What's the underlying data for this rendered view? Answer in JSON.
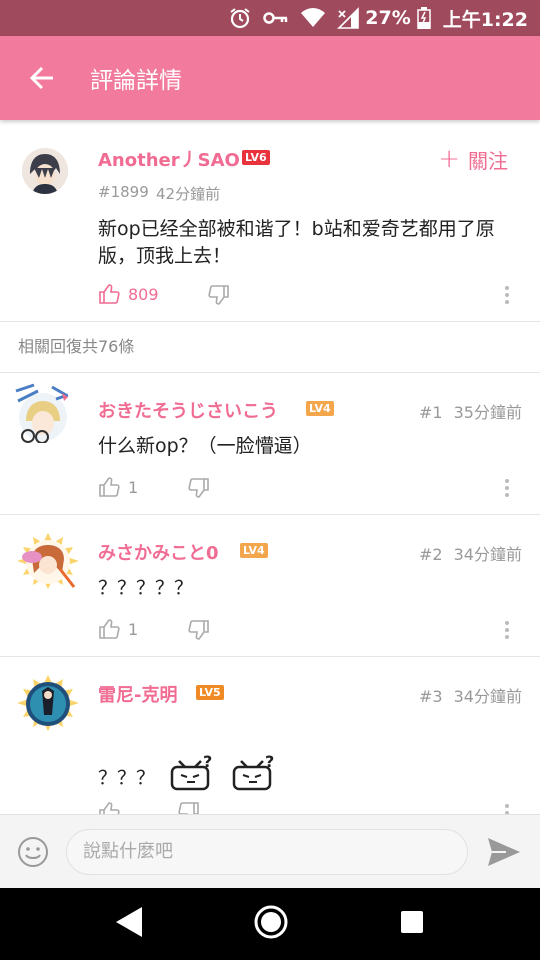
{
  "status_bar": {
    "battery": "27%",
    "time": "上午1:22",
    "icons": [
      "alarm-icon",
      "key-icon",
      "wifi-icon",
      "signal-icon",
      "battery-icon"
    ]
  },
  "app_bar": {
    "title": "評論詳情",
    "back_icon": "arrow-left-icon"
  },
  "main_comment": {
    "username": "Another丿SAO",
    "level": "LV6",
    "id": "#1899",
    "time": "42分鐘前",
    "text": "新op已经全部被和谐了！b站和爱奇艺都用了原版，顶我上去！",
    "likes": "809",
    "follow_label": "關注"
  },
  "replies_header": "相關回復共76條",
  "replies": [
    {
      "username": "おきたそうじさいこう",
      "level": "LV4",
      "floor": "#1",
      "time": "35分鐘前",
      "text": "什么新op？（一脸懵逼）",
      "likes": "1"
    },
    {
      "username": "みさかみこと0",
      "level": "LV4",
      "floor": "#2",
      "time": "34分鐘前",
      "text": "？？？？？",
      "likes": "1"
    },
    {
      "username": "雷尼-克明",
      "level": "LV5",
      "floor": "#3",
      "time": "34分鐘前",
      "text": "？？？",
      "likes": ""
    }
  ],
  "input": {
    "placeholder": "說點什麼吧"
  },
  "colors": {
    "accent": "#f27a9c",
    "status_bar": "#a04a5e",
    "username": "#f06c92",
    "lv6": "#e8323c",
    "lv4": "#f4a64c",
    "lv5": "#f08a24"
  }
}
